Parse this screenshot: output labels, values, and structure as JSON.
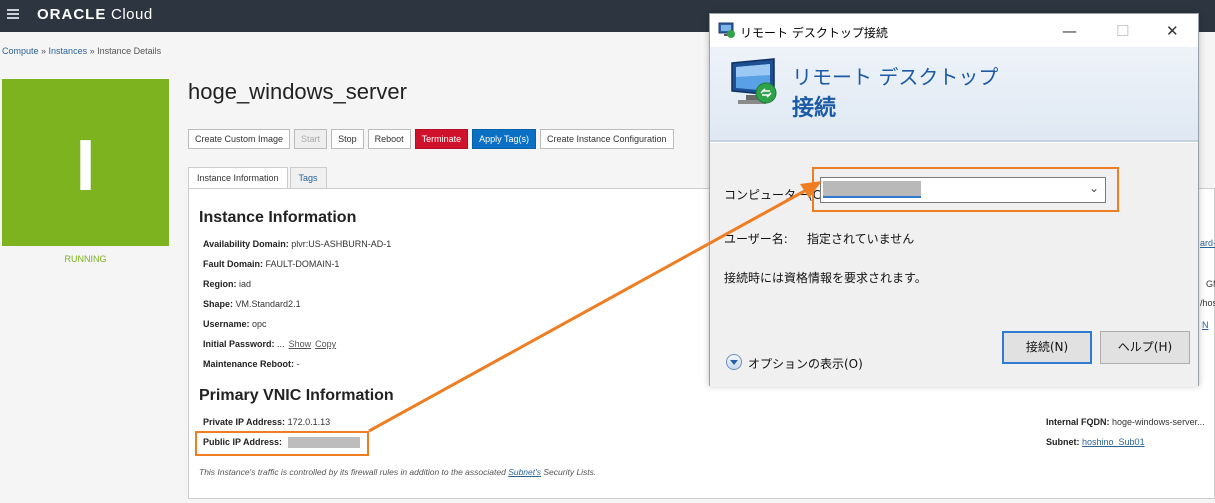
{
  "header": {
    "brand_bold": "ORACLE",
    "brand_rest": " Cloud"
  },
  "breadcrumb": {
    "items": [
      "Compute",
      "Instances",
      "Instance Details"
    ],
    "sep": " » "
  },
  "instance": {
    "icon_letter": "I",
    "state": "RUNNING",
    "name": "hoge_windows_server"
  },
  "actions": [
    "Create Custom Image",
    "Start",
    "Stop",
    "Reboot",
    "Terminate",
    "Apply Tag(s)",
    "Create Instance Configuration"
  ],
  "tabs": [
    "Instance Information",
    "Tags"
  ],
  "info": {
    "heading": "Instance Information",
    "rows": [
      {
        "label": "Availability Domain:",
        "value": "plvr:US-ASHBURN-AD-1"
      },
      {
        "label": "Fault Domain:",
        "value": "FAULT-DOMAIN-1"
      },
      {
        "label": "Region:",
        "value": "iad"
      },
      {
        "label": "Shape:",
        "value": "VM.Standard2.1"
      },
      {
        "label": "Username:",
        "value": "opc"
      },
      {
        "label": "Initial Password:",
        "value": "...",
        "links": [
          "Show",
          "Copy"
        ]
      },
      {
        "label": "Maintenance Reboot:",
        "value": "-"
      }
    ]
  },
  "vnic": {
    "heading": "Primary VNIC Information",
    "private_ip_label": "Private IP Address:",
    "private_ip": "172.0.1.13",
    "public_ip_label": "Public IP Address:",
    "fqdn_label": "Internal FQDN:",
    "fqdn": "hoge-windows-server...",
    "subnet_label": "Subnet:",
    "subnet": "hoshino_Sub01",
    "note_pre": "This Instance's traffic is controlled by its firewall rules in addition to the associated ",
    "note_link": "Subnet's",
    "note_post": " Security Lists."
  },
  "right_fragments": [
    "ard-",
    "GM",
    "/hos",
    "N"
  ],
  "dialog": {
    "title": "リモート デスクトップ接続",
    "banner_line1": "リモート デスクトップ",
    "banner_line2": "接続",
    "computer_label": "コンピューター(C):",
    "user_label": "ユーザー名:",
    "user_value": "指定されていません",
    "info_text": "接続時には資格情報を要求されます。",
    "options_label": "オプションの表示(O)",
    "connect_button": "接続(N)",
    "help_button": "ヘルプ(H)"
  },
  "colors": {
    "running": "#7db31f",
    "terminate": "#d0112b",
    "apply": "#0a70c4",
    "highlight": "#ef7d22"
  }
}
